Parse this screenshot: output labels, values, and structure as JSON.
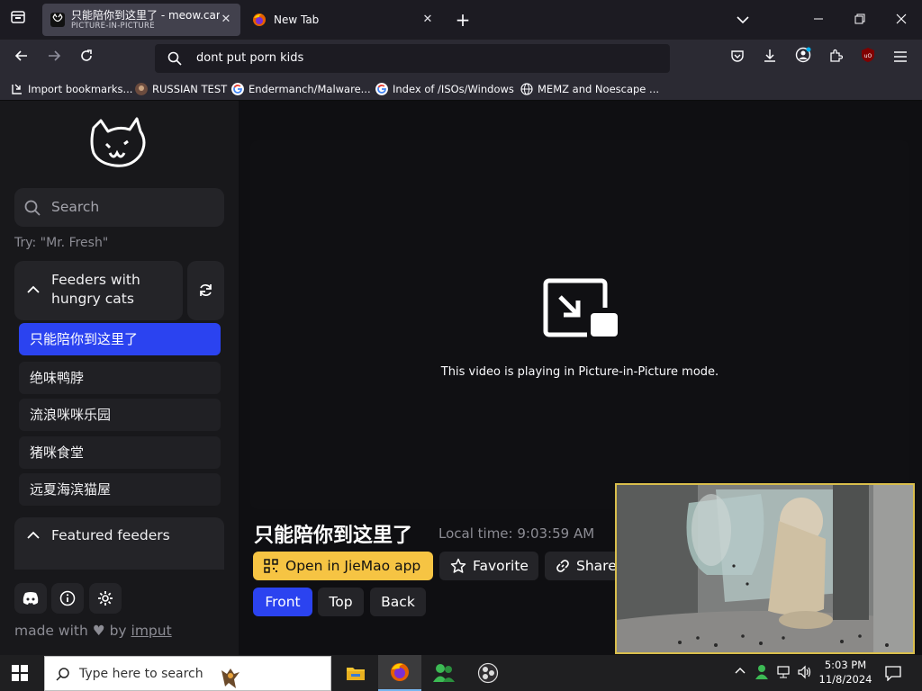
{
  "tabs": [
    {
      "title": "只能陪你到这里了 - meow.camera",
      "subtitle": "PICTURE-IN-PICTURE",
      "active": true
    },
    {
      "title": "New Tab",
      "active": false
    }
  ],
  "address_bar": {
    "query": "dont put porn kids"
  },
  "bookmarks": [
    {
      "label": "Import bookmarks...",
      "icon": "import-icon"
    },
    {
      "label": "RUSSIAN TEST",
      "icon": "site-icon"
    },
    {
      "label": "Endermanch/Malware...",
      "icon": "google-icon"
    },
    {
      "label": "Index of /ISOs/Windows",
      "icon": "google-icon"
    },
    {
      "label": "MEMZ and Noescape ...",
      "icon": "globe-icon"
    }
  ],
  "sidebar": {
    "search_placeholder": "Search",
    "hint": "Try: \"Mr. Fresh\"",
    "section_title": "Feeders with hungry cats",
    "items": [
      "只能陪你到这里了",
      "绝味鸭脖",
      "流浪咪咪乐园",
      "猪咪食堂",
      "远夏海滨猫屋"
    ],
    "selected_index": 0,
    "featured_title": "Featured feeders",
    "footer": {
      "prefix": "made with",
      "by": "by",
      "link": "imput"
    }
  },
  "main": {
    "pip_message": "This video is playing in Picture-in-Picture mode.",
    "feeder_name": "只能陪你到这里了",
    "local_time": "Local time: 9:03:59 AM",
    "open_app_label": "Open in JieMao app",
    "favorite_label": "Favorite",
    "share_label": "Share",
    "cameras": [
      "Front",
      "Top",
      "Back"
    ],
    "selected_camera": 0
  },
  "taskbar": {
    "search_placeholder": "Type here to search",
    "time": "5:03 PM",
    "date": "11/8/2024"
  },
  "colors": {
    "accent_blue": "#2b43f0",
    "accent_yellow": "#f6c443",
    "pip_border": "#d9be4c"
  }
}
